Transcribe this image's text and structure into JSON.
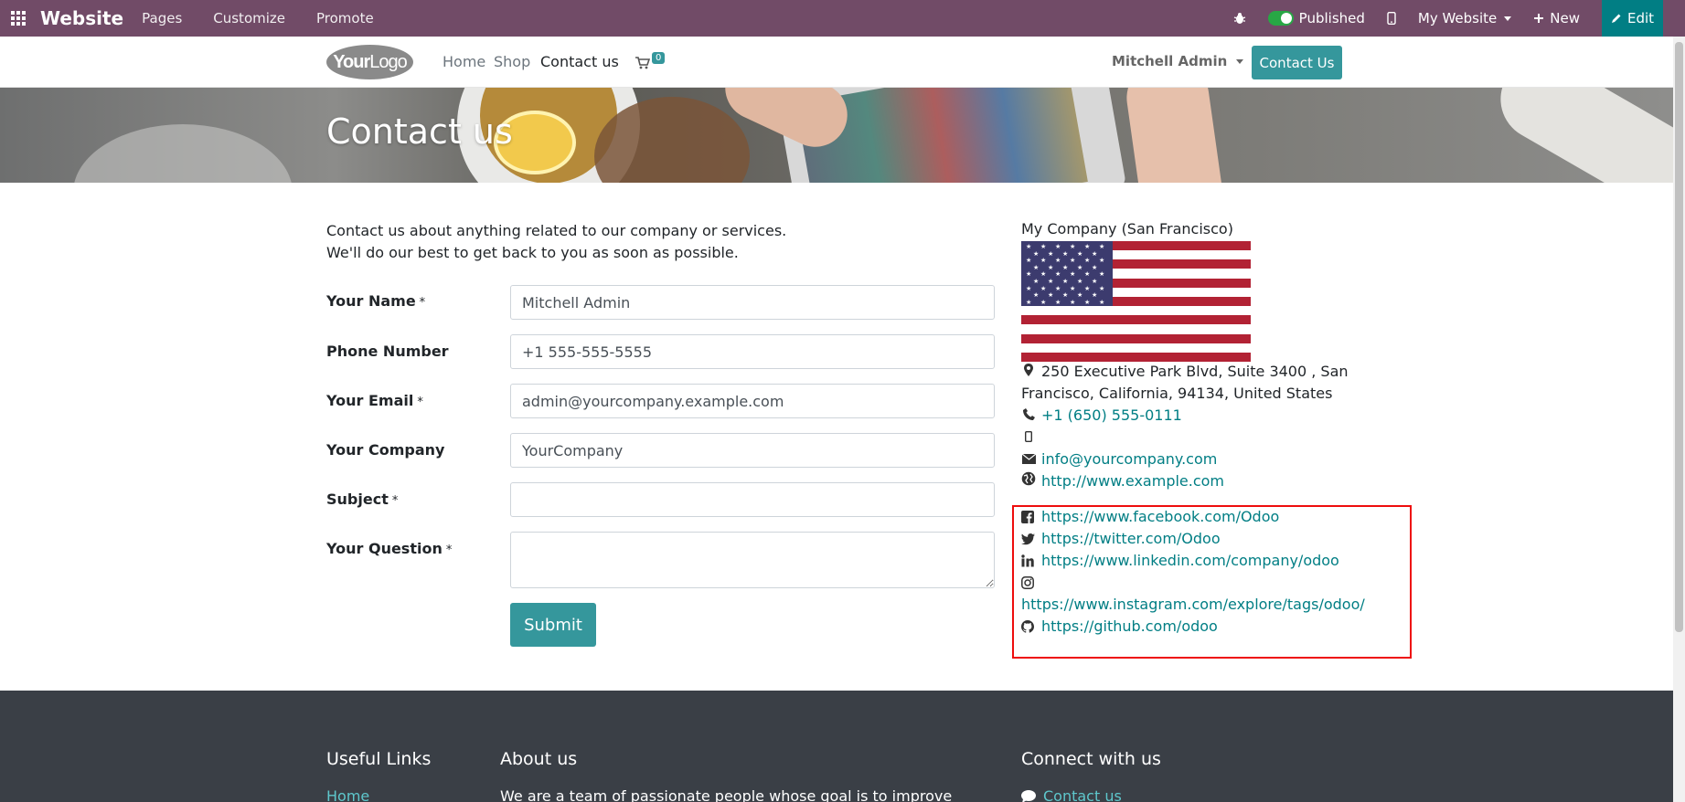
{
  "admin_bar": {
    "brand": "Website",
    "menu": [
      "Pages",
      "Customize",
      "Promote"
    ],
    "published_label": "Published",
    "my_website_label": "My Website",
    "new_label": "New",
    "edit_label": "Edit",
    "colors": {
      "bar": "#714b67",
      "edit": "#017e84",
      "toggle": "#28a745"
    }
  },
  "header": {
    "logo_text_bold": "Your",
    "logo_text_thin": "Logo",
    "nav": [
      "Home",
      "Shop",
      "Contact us"
    ],
    "active_nav": "Contact us",
    "cart_count": "0",
    "user_name": "Mitchell Admin",
    "contact_button": "Contact Us",
    "accent": "#35979c"
  },
  "banner": {
    "title": "Contact us"
  },
  "intro": {
    "line1": "Contact us about anything related to our company or services.",
    "line2": "We'll do our best to get back to you as soon as possible."
  },
  "form": {
    "fields": [
      {
        "label": "Your Name",
        "required": "*",
        "value": "Mitchell Admin"
      },
      {
        "label": "Phone Number",
        "required": "",
        "value": "+1 555-555-5555"
      },
      {
        "label": "Your Email",
        "required": "*",
        "value": "admin@yourcompany.example.com"
      },
      {
        "label": "Your Company",
        "required": "",
        "value": "YourCompany"
      },
      {
        "label": "Subject",
        "required": "*",
        "value": ""
      },
      {
        "label": "Your Question",
        "required": "*",
        "value": ""
      }
    ],
    "submit_label": "Submit"
  },
  "company": {
    "name": "My Company (San Francisco)",
    "address_line1": "250 Executive Park Blvd, Suite 3400 , San",
    "address_line2": "Francisco, California, 94134, United States",
    "phone": "+1 (650) 555-0111",
    "email": "info@yourcompany.com",
    "website": "http://www.example.com",
    "flag_colors": {
      "red": "#b22234",
      "white": "#ffffff",
      "blue": "#3c3b6e"
    }
  },
  "social": {
    "facebook": "https://www.facebook.com/Odoo",
    "twitter": "https://twitter.com/Odoo",
    "linkedin": "https://www.linkedin.com/company/odoo",
    "instagram": "https://www.instagram.com/explore/tags/odoo/",
    "github": "https://github.com/odoo",
    "highlight_color": "#ee0d0d"
  },
  "footer": {
    "useful_links_title": "Useful Links",
    "useful_links_first": "Home",
    "about_title": "About us",
    "about_text": "We are a team of passionate people whose goal is to improve",
    "connect_title": "Connect with us",
    "connect_first": "Contact us",
    "bg": "#3a3f46"
  }
}
